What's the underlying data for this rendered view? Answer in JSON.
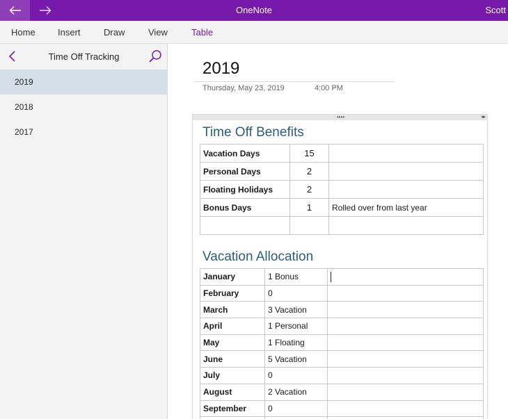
{
  "app": {
    "title": "OneNote",
    "user": "Scott"
  },
  "ribbon": {
    "tabs": [
      {
        "label": "Home"
      },
      {
        "label": "Insert"
      },
      {
        "label": "Draw"
      },
      {
        "label": "View"
      },
      {
        "label": "Table",
        "active": true
      }
    ]
  },
  "sidebar": {
    "section_title": "Time Off Tracking",
    "pages": [
      {
        "label": "2019",
        "selected": true
      },
      {
        "label": "2018"
      },
      {
        "label": "2017"
      }
    ]
  },
  "page": {
    "title": "2019",
    "date": "Thursday, May 23, 2019",
    "time": "4:00 PM",
    "benefits_heading": "Time Off Benefits",
    "benefits": [
      {
        "name": "Vacation Days",
        "days": "15",
        "note": ""
      },
      {
        "name": "Personal Days",
        "days": "2",
        "note": ""
      },
      {
        "name": "Floating Holidays",
        "days": "2",
        "note": ""
      },
      {
        "name": "Bonus Days",
        "days": "1",
        "note": "Rolled over from last year"
      },
      {
        "name": "",
        "days": "",
        "note": ""
      }
    ],
    "allocation_heading": "Vacation Allocation",
    "allocation": [
      {
        "month": "January",
        "value": "1 Bonus",
        "note": ""
      },
      {
        "month": "February",
        "value": "0",
        "note": ""
      },
      {
        "month": "March",
        "value": "3 Vacation",
        "note": ""
      },
      {
        "month": "April",
        "value": "1 Personal",
        "note": ""
      },
      {
        "month": "May",
        "value": "1 Floating",
        "note": ""
      },
      {
        "month": "June",
        "value": "5 Vacation",
        "note": ""
      },
      {
        "month": "July",
        "value": "0",
        "note": ""
      },
      {
        "month": "August",
        "value": "2 Vacation",
        "note": ""
      },
      {
        "month": "September",
        "value": "0",
        "note": ""
      }
    ]
  },
  "icons": {
    "back": "arrow-left-icon",
    "forward": "arrow-right-icon",
    "sidebar_back": "chevron-left-icon",
    "search": "search-icon"
  },
  "colors": {
    "accent": "#7719aa",
    "heading": "#2b5d7d",
    "selected_page": "#d5dfe8"
  }
}
